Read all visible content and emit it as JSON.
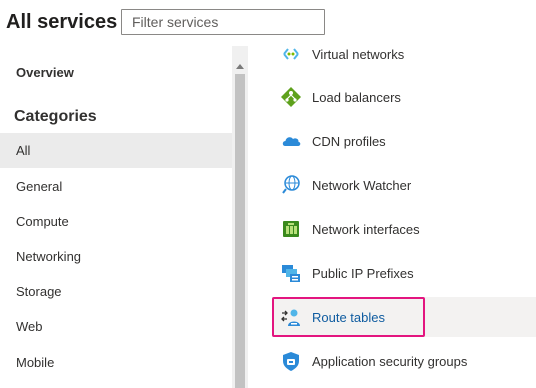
{
  "header": {
    "title": "All services",
    "filter_placeholder": "Filter services"
  },
  "sidebar": {
    "overview": "Overview",
    "categories_heading": "Categories",
    "items": [
      {
        "label": "All",
        "selected": true
      },
      {
        "label": "General"
      },
      {
        "label": "Compute"
      },
      {
        "label": "Networking"
      },
      {
        "label": "Storage"
      },
      {
        "label": "Web"
      },
      {
        "label": "Mobile"
      }
    ]
  },
  "services": [
    {
      "label": "Virtual networks",
      "icon": "virtual-network-icon"
    },
    {
      "label": "Load balancers",
      "icon": "load-balancer-icon"
    },
    {
      "label": "CDN profiles",
      "icon": "cdn-cloud-icon"
    },
    {
      "label": "Network Watcher",
      "icon": "globe-icon"
    },
    {
      "label": "Network interfaces",
      "icon": "network-interface-icon"
    },
    {
      "label": "Public IP Prefixes",
      "icon": "public-ip-icon"
    },
    {
      "label": "Route tables",
      "icon": "route-table-icon",
      "highlighted": true
    },
    {
      "label": "Application security groups",
      "icon": "shield-icon"
    }
  ],
  "colors": {
    "accent": "#0078d4",
    "highlight_border": "#e3157f",
    "selected_bg": "#ebebeb"
  }
}
